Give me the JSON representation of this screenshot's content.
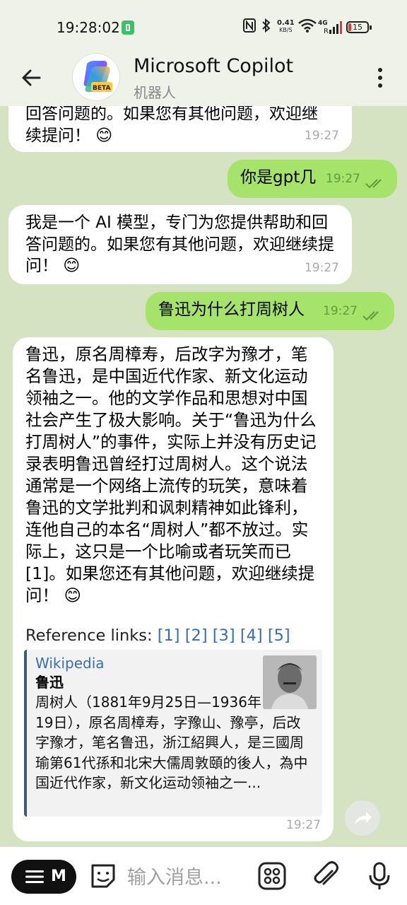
{
  "status": {
    "time": "19:28:02",
    "net_speed": "0.41",
    "net_unit": "KB/S",
    "net_gen": "4G",
    "battery": "15"
  },
  "header": {
    "title": "Microsoft Copilot",
    "subtitle": "机器人",
    "avatar_badge": "BETA"
  },
  "messages": [
    {
      "dir": "in",
      "text": "回答问题的。如果您有其他问题，欢迎继续提问！ 😊",
      "time": "19:27"
    },
    {
      "dir": "out",
      "text": "你是gpt几",
      "time": "19:27"
    },
    {
      "dir": "in",
      "text": "我是一个 AI 模型，专门为您提供帮助和回答问题的。如果您有其他问题，欢迎继续提问！ 😊",
      "time": "19:27"
    },
    {
      "dir": "out",
      "text": "鲁迅为什么打周树人",
      "time": "19:27"
    },
    {
      "dir": "in",
      "text": "鲁迅，原名周樟寿，后改字为豫才，笔名鲁迅，是中国近代作家、新文化运动领袖之一。他的文学作品和思想对中国社会产生了极大影响。关于“鲁迅为什么打周树人”的事件，实际上并没有历史记录表明鲁迅曾经打过周树人。这个说法通常是一个网络上流传的玩笑，意味着鲁迅的文学批判和讽刺精神如此锋利，连他自己的本名“周树人”都不放过。实际上，这只是一个比喻或者玩笑而已[1]。如果您还有其他问题，欢迎继续提问！ 😊",
      "refs_label": "Reference links:",
      "refs": [
        "[1]",
        "[2]",
        "[3]",
        "[4]",
        "[5]"
      ],
      "card": {
        "site": "Wikipedia",
        "title": "鲁迅",
        "desc": "周树人（1881年9月25日—1936年10月19日），原名周樟寿，字豫山、豫亭，后改字豫才，笔名鲁迅，浙江紹興人，是三國周瑜第61代孫和北宋大儒周敦頤的後人，為中国近代作家，新文化运动领袖之一..."
      },
      "time": "19:27"
    }
  ],
  "input": {
    "menu_label": "M",
    "placeholder": "输入消息..."
  },
  "colors": {
    "background": "#d6e3c2",
    "outgoing_bubble": "#a5e36b",
    "incoming_bubble": "#ffffff",
    "link": "#3a6db3"
  }
}
